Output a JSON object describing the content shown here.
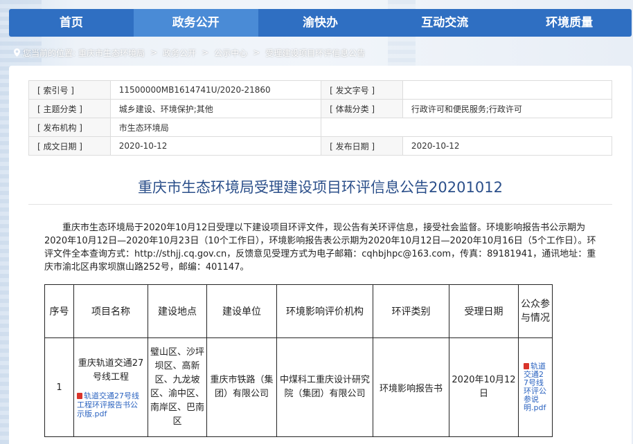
{
  "nav": {
    "items": [
      "首页",
      "政务公开",
      "渝快办",
      "互动交流",
      "环境质量"
    ],
    "active_index": 1
  },
  "breadcrumb": {
    "prefix": "您当前的位置:",
    "items": [
      "重庆市生态环境局",
      "政务公开",
      "公示中心",
      "受理建设项目环评信息公告"
    ],
    "separator": ">"
  },
  "meta": {
    "index_label": "[ 索引号 ]",
    "index_value": "11500000MB1614741U/2020-21860",
    "docno_label": "[ 发文字号 ]",
    "docno_value": "",
    "topic_label": "[ 主题分类 ]",
    "topic_value": "城乡建设、环境保护;其他",
    "genre_label": "[ 体裁分类 ]",
    "genre_value": "行政许可和便民服务;行政许可",
    "issuer_label": "[ 发布机构 ]",
    "issuer_value": "市生态环境局",
    "created_label": "[ 成文日期 ]",
    "created_value": "2020-10-12",
    "published_label": "[ 发布日期 ]",
    "published_value": "2020-10-12"
  },
  "article": {
    "title": "重庆市生态环境局受理建设项目环评信息公告20201012",
    "paragraph": "重庆市生态环境局于2020年10月12日受理以下建设项目环评文件，现公告有关环评信息，接受社会监督。环境影响报告书公示期为2020年10月12日—2020年10月23日（10个工作日），环境影响报告表公示期为2020年10月12日—2020年10月16日（5个工作日）。环评文件全本查询方式：http://sthjj.cq.gov.cn，反馈意见受理方式为电子邮箱：cqhbjhpc@163.com，传真：89181941，通讯地址：重庆市渝北区冉家坝旗山路252号，邮编：401147。"
  },
  "table": {
    "headers": [
      "序号",
      "项目名称",
      "建设地点",
      "建设单位",
      "环境影响评价机构",
      "环评类别",
      "受理日期",
      "公众参与情况"
    ],
    "rows": [
      {
        "no": "1",
        "project": "重庆轨道交通27号线工程",
        "project_file": "轨道交通27号线工程环评报告书公示版.pdf",
        "location": "璧山区、沙坪坝区、高新区、九龙坡区、渝中区、南岸区、巴南区",
        "builder": "重庆市铁路（集团）有限公司",
        "agency": "中煤科工重庆设计研究院（集团）有限公司",
        "category": "环境影响报告书",
        "date": "2020年10月12日",
        "public_file": "轨道交通27号线环评公参说明.pdf"
      }
    ]
  }
}
